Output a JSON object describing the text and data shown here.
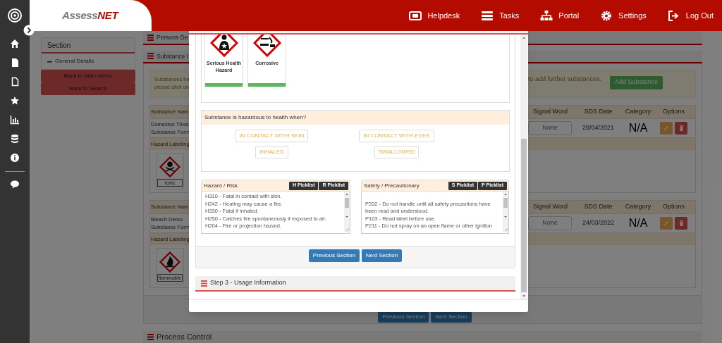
{
  "header": {
    "logo": [
      "Assess",
      "NET"
    ],
    "nav": [
      {
        "label": "Helpdesk"
      },
      {
        "label": "Tasks"
      },
      {
        "label": "Portal"
      },
      {
        "label": "Settings"
      },
      {
        "label": "Log Out"
      }
    ]
  },
  "section_panel": {
    "title": "Section",
    "items": [
      {
        "label": "General Details",
        "expanded": true
      }
    ],
    "buttons": [
      "Back to Main Menu",
      "Back to Search"
    ]
  },
  "page": {
    "panels": [
      "Persons De",
      "Substance I"
    ],
    "alert": {
      "lines": [
        "Substances ha",
        "please click on"
      ],
      "tail": "to add further substances.",
      "button": "Add Substance"
    },
    "substances": [
      {
        "name_header": "Substance Nam",
        "columns": [
          "Signal Word",
          "SDS Date",
          "Category",
          "Options"
        ],
        "name": "Domestos Thick",
        "form": "Substance Form",
        "signal_word": "None",
        "sds_date": "28/04/2021",
        "category": "N/A",
        "labeling": "Hazard Labeling",
        "pictograms": [
          {
            "kind": "toxic",
            "label": "toxic"
          }
        ]
      },
      {
        "name_header": "Substance Nam",
        "columns": [
          "Signal Word",
          "SDS Date",
          "Category",
          "Options"
        ],
        "name": "Bleach Demo",
        "form": "Substance Form",
        "signal_word": "None",
        "sds_date": "24/03/2022",
        "category": "N/A",
        "labeling": "Hazard Labeling",
        "pictograms": [
          {
            "kind": "flammable",
            "label": "flammable"
          }
        ]
      }
    ],
    "nav_buttons": [
      "Previous Section",
      "Next Section"
    ],
    "next_panel": "Process Control"
  },
  "modal": {
    "pictograms": [
      {
        "kind": "health",
        "label": "Serious Health Hazard",
        "selected": true
      },
      {
        "kind": "corrosive",
        "label": "Corrosive",
        "selected": true
      }
    ],
    "routes": {
      "question": "Substance is hazardous to health when?",
      "options": [
        {
          "label": "IN CONTACT WITH SKIN",
          "selected": false
        },
        {
          "label": "IN CONTACT WITH EYES",
          "selected": false
        },
        {
          "label": "INHALED",
          "selected": false
        },
        {
          "label": "SWALLOWED",
          "selected": false
        }
      ]
    },
    "statement_panels": [
      {
        "title": "Hazard / Risk",
        "buttons": [
          "H Picklist",
          "R Picklist"
        ],
        "lines": [
          "H310 - Fatal in contact with skin.",
          "H242 - Heating may cause a fire.",
          "H330 - Fatal if inhaled.",
          "H250 - Catches fire spontaneously if exposed to air.",
          "H204 - Fire or projection hazard."
        ]
      },
      {
        "title": "Safety / Precautionary",
        "buttons": [
          "S Picklist",
          "P Picklist"
        ],
        "lines": [
          "P202 - Do not handle until all safety precautions have been read and understood.",
          "P103 - Read label before use.",
          "P211 - Do not spray on an open flame or other ignition"
        ]
      }
    ],
    "nav_buttons": [
      "Previous Section",
      "Next Section"
    ],
    "next_step": "Step 3 - Usage Information"
  }
}
